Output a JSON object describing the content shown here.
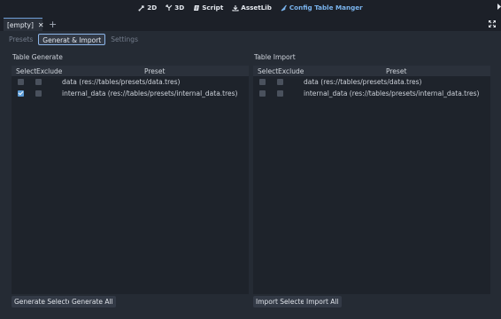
{
  "topbar": {
    "workspaces": [
      {
        "label": "2D",
        "icon": "2d-icon"
      },
      {
        "label": "3D",
        "icon": "3d-icon"
      },
      {
        "label": "Script",
        "icon": "script-icon"
      },
      {
        "label": "AssetLib",
        "icon": "assetlib-icon"
      },
      {
        "label": "Config Table Manger",
        "icon": "config-table-icon",
        "active": true
      }
    ]
  },
  "scene_tabs": {
    "current": "[empty]",
    "close": "✕",
    "add": "+"
  },
  "subtabs": [
    "Presets",
    "Generat & Import",
    "Settings"
  ],
  "generate": {
    "title": "Table Generate",
    "headers": {
      "select": "Select",
      "exclude": "Exclude",
      "preset": "Preset"
    },
    "rows": [
      {
        "preset": "data (res://tables/presets/data.tres)",
        "selected": false,
        "exclude": false
      },
      {
        "preset": "internal_data (res://tables/presets/internal_data.tres)",
        "selected": true,
        "exclude": false
      }
    ],
    "buttons": {
      "selected": "Generate Selected",
      "all": "Generate All"
    }
  },
  "import": {
    "title": "Table Import",
    "headers": {
      "select": "Select",
      "exclude": "Exclude",
      "preset": "Preset"
    },
    "rows": [
      {
        "preset": "data (res://tables/presets/data.tres)",
        "selected": false,
        "exclude": false
      },
      {
        "preset": "internal_data (res://tables/presets/internal_data.tres)",
        "selected": false,
        "exclude": false
      }
    ],
    "buttons": {
      "selected": "Import Selected",
      "all": "Import All"
    }
  },
  "colors": {
    "background": "#1c2028",
    "panel": "#252b34",
    "accent": "#7ab4ee",
    "checkbox_checked": "#5c9bd6"
  }
}
